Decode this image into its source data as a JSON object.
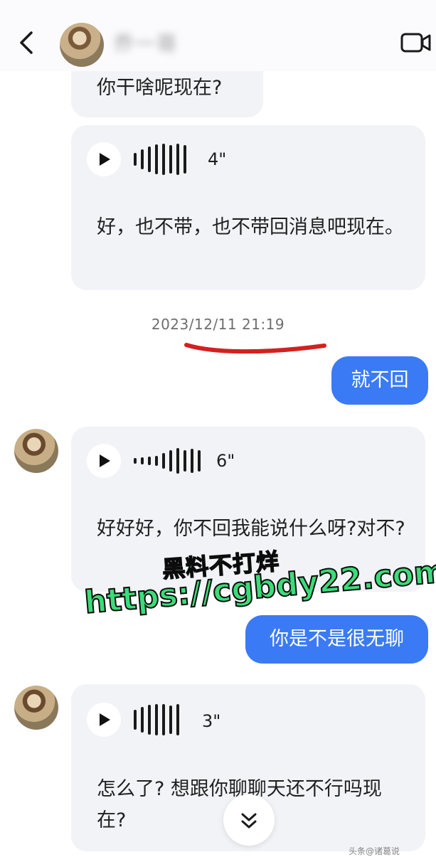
{
  "header": {
    "contact_name": "乔一哥",
    "back_icon": "chevron-left-icon",
    "video_icon": "video-camera-icon"
  },
  "messages": {
    "m1_text": "你干啥呢现在?",
    "m2_duration": "4\"",
    "m2_transcript": "好，也不带，也不带回消息吧现在。",
    "timestamp": "2023/12/11 21:19",
    "out1_text": "就不回",
    "m3_duration": "6\"",
    "m3_transcript": "好好好，你不回我能说什么呀?对不?",
    "out2_text": "你是不是很无聊",
    "m4_duration": "3\"",
    "m4_transcript": "怎么了? 想跟你聊聊天还不行吗现在?"
  },
  "watermark": {
    "line1": "黑料不打烊",
    "line2": "https://cgbdy22.com"
  },
  "footer": {
    "text": "头条@诸葛说"
  },
  "colors": {
    "outgoing_bubble": "#3a7bf5",
    "incoming_bubble": "#f2f3f7",
    "annotation_red": "#d42020",
    "watermark_green": "#3bdc7a"
  }
}
